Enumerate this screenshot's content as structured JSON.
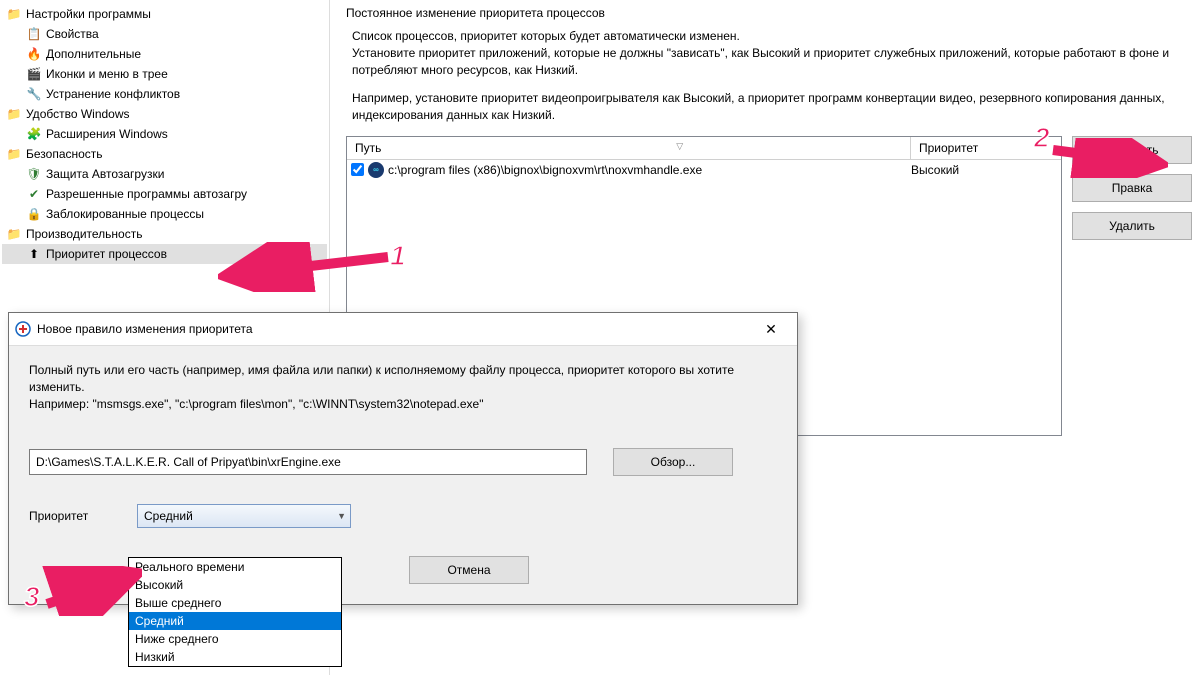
{
  "sidebar": {
    "items": [
      {
        "label": "Настройки программы",
        "level": 0,
        "icon": "folder"
      },
      {
        "label": "Свойства",
        "level": 1,
        "icon": "properties"
      },
      {
        "label": "Дополнительные",
        "level": 1,
        "icon": "additional"
      },
      {
        "label": "Иконки и меню в трее",
        "level": 1,
        "icon": "tray"
      },
      {
        "label": "Устранение конфликтов",
        "level": 1,
        "icon": "conflict"
      },
      {
        "label": "Удобство Windows",
        "level": 0,
        "icon": "folder"
      },
      {
        "label": "Расширения Windows",
        "level": 1,
        "icon": "extensions"
      },
      {
        "label": "Безопасность",
        "level": 0,
        "icon": "folder"
      },
      {
        "label": "Защита Автозагрузки",
        "level": 1,
        "icon": "shield"
      },
      {
        "label": "Разрешенные программы автозагру",
        "level": 1,
        "icon": "check"
      },
      {
        "label": "Заблокированные процессы",
        "level": 1,
        "icon": "blocked"
      },
      {
        "label": "Производительность",
        "level": 0,
        "icon": "folder"
      },
      {
        "label": "Приоритет процессов",
        "level": 1,
        "icon": "priority",
        "selected": true
      }
    ]
  },
  "content": {
    "title": "Постоянное изменение приоритета процессов",
    "desc1": "Список процессов, приоритет которых будет автоматически изменен.",
    "desc2": "Установите приоритет приложений, которые не должны \"зависать\", как Высокий и приоритет служебных приложений, которые работают в фоне и потребляют много ресурсов, как Низкий.",
    "desc3": "Например, установите приоритет видеопроигрывателя как Высокий, а приоритет программ конвертации видео, резервного копирования данных, индексирования данных как Низкий."
  },
  "table": {
    "col_path": "Путь",
    "col_priority": "Приоритет",
    "rows": [
      {
        "path": "c:\\program files (x86)\\bignox\\bignoxvm\\rt\\noxvmhandle.exe",
        "priority": "Высокий"
      }
    ]
  },
  "buttons": {
    "add": "Добавить",
    "edit": "Правка",
    "delete": "Удалить"
  },
  "dialog": {
    "title": "Новое правило изменения приоритета",
    "text1": "Полный путь или его часть (например, имя файла или папки) к исполняемому файлу процесса, приоритет которого вы хотите изменить.",
    "text2": "Например: \"msmsgs.exe\", \"c:\\program files\\mon\", \"c:\\WINNT\\system32\\notepad.exe\"",
    "path_value": "D:\\Games\\S.T.A.L.K.E.R. Call of Pripyat\\bin\\xrEngine.exe",
    "browse": "Обзор...",
    "priority_label": "Приоритет",
    "selected_priority": "Средний",
    "cancel": "Отмена"
  },
  "dropdown": {
    "items": [
      "Реального времени",
      "Высокий",
      "Выше среднего",
      "Средний",
      "Ниже среднего",
      "Низкий"
    ],
    "selected_index": 3
  },
  "annotations": {
    "num1": "1",
    "num2": "2",
    "num3": "3"
  }
}
